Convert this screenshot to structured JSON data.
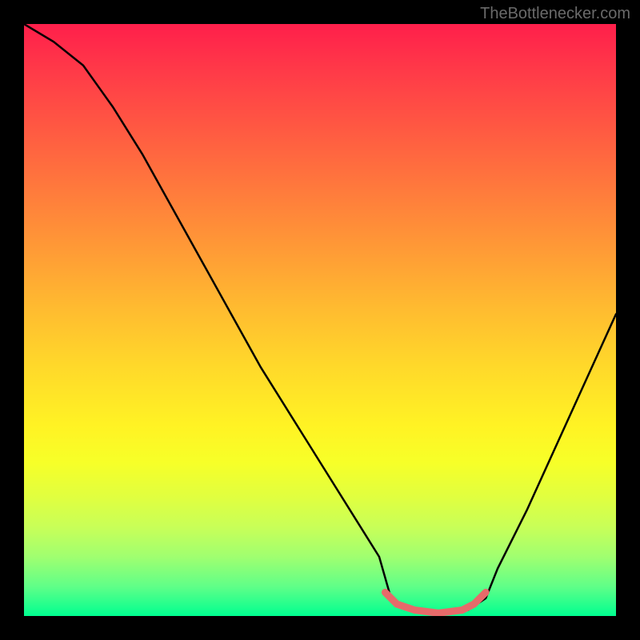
{
  "watermark": "TheBottlenecker.com",
  "chart_data": {
    "type": "line",
    "title": "",
    "xlabel": "",
    "ylabel": "",
    "xlim": [
      0,
      100
    ],
    "ylim": [
      0,
      100
    ],
    "description": "Bottleneck curve over a red-to-green vertical gradient background. Lower y = better (green); higher y = worse (red). The curve descends from top-left, bottoms out around x≈62–75, then rises toward the right. A short pink overlay segment highlights the near-minimum region.",
    "series": [
      {
        "name": "bottleneck-curve",
        "color": "#000000",
        "x": [
          0,
          5,
          10,
          15,
          20,
          25,
          30,
          35,
          40,
          45,
          50,
          55,
          60,
          62,
          65,
          70,
          75,
          78,
          80,
          85,
          90,
          95,
          100
        ],
        "values": [
          100,
          97,
          93,
          86,
          78,
          69,
          60,
          51,
          42,
          34,
          26,
          18,
          10,
          3,
          1,
          0.5,
          1,
          3,
          8,
          18,
          29,
          40,
          51
        ]
      },
      {
        "name": "optimal-band-highlight",
        "color": "#e76a6a",
        "x": [
          61,
          63,
          66,
          70,
          74,
          76,
          78
        ],
        "values": [
          4,
          2,
          1,
          0.5,
          1,
          2,
          4
        ]
      }
    ]
  }
}
